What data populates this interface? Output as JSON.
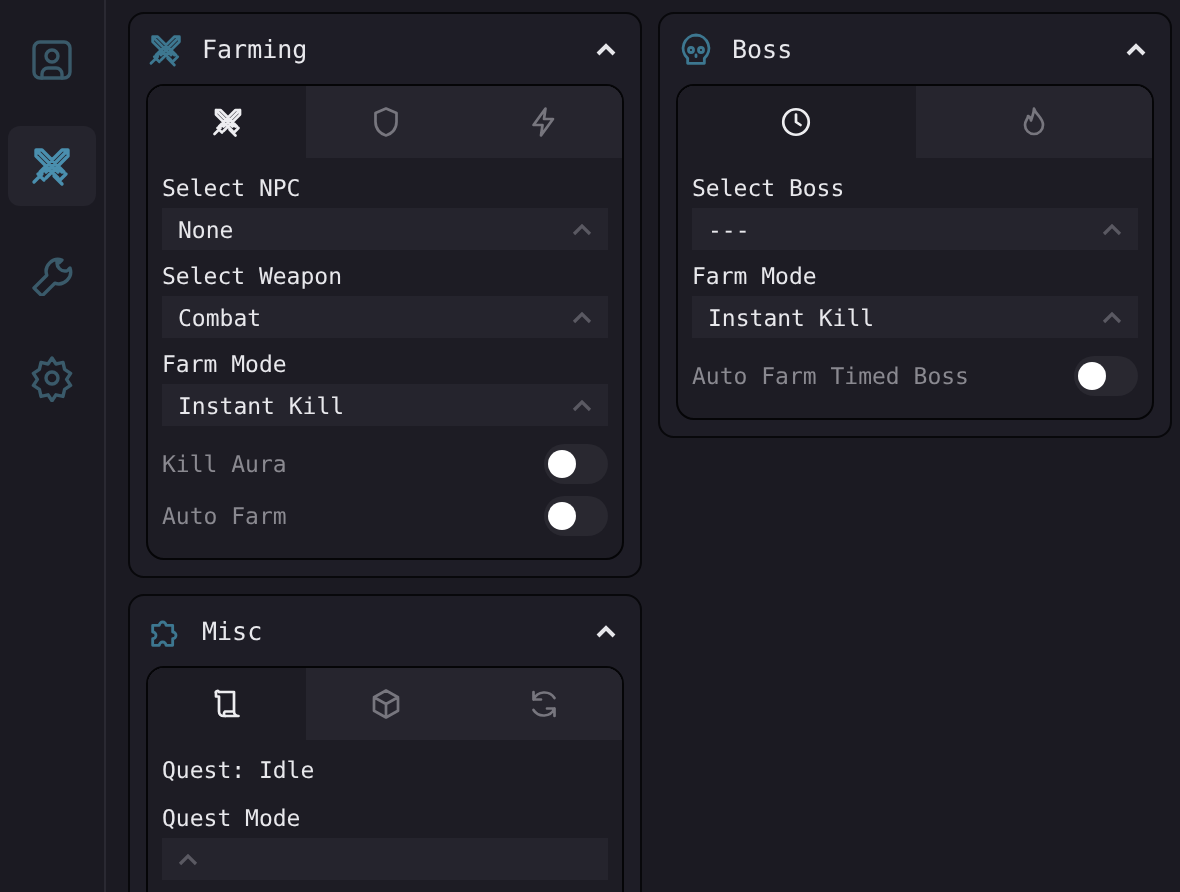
{
  "sidebar": {
    "items": [
      {
        "selected": false
      },
      {
        "selected": true
      },
      {
        "selected": false
      },
      {
        "selected": false
      }
    ]
  },
  "columns": [
    {
      "panels": [
        {
          "title": "Farming",
          "expanded": true,
          "tabs": [
            {
              "selected": true
            },
            {
              "selected": false
            },
            {
              "selected": false
            }
          ],
          "controls": [
            {
              "kind": "dropdown",
              "label": "Select NPC",
              "value": "None"
            },
            {
              "kind": "dropdown",
              "label": "Select Weapon",
              "value": "Combat"
            },
            {
              "kind": "dropdown",
              "label": "Farm Mode",
              "value": "Instant Kill"
            },
            {
              "kind": "toggle",
              "label": "Kill Aura",
              "on": false
            },
            {
              "kind": "toggle",
              "label": "Auto Farm",
              "on": false
            }
          ]
        },
        {
          "title": "Misc",
          "expanded": true,
          "tabs": [
            {
              "selected": true
            },
            {
              "selected": false
            },
            {
              "selected": false
            }
          ],
          "controls": [
            {
              "kind": "status",
              "label": "Quest: Idle"
            },
            {
              "kind": "dropdown",
              "label": "Quest Mode"
            }
          ]
        }
      ]
    },
    {
      "panels": [
        {
          "title": "Boss",
          "expanded": true,
          "tabs": [
            {
              "selected": true
            },
            {
              "selected": false
            }
          ],
          "controls": [
            {
              "kind": "dropdown",
              "label": "Select Boss",
              "value": "---"
            },
            {
              "kind": "dropdown",
              "label": "Farm Mode",
              "value": "Instant Kill"
            },
            {
              "kind": "toggle",
              "label": "Auto Farm Timed Boss",
              "on": false
            }
          ]
        }
      ]
    }
  ]
}
